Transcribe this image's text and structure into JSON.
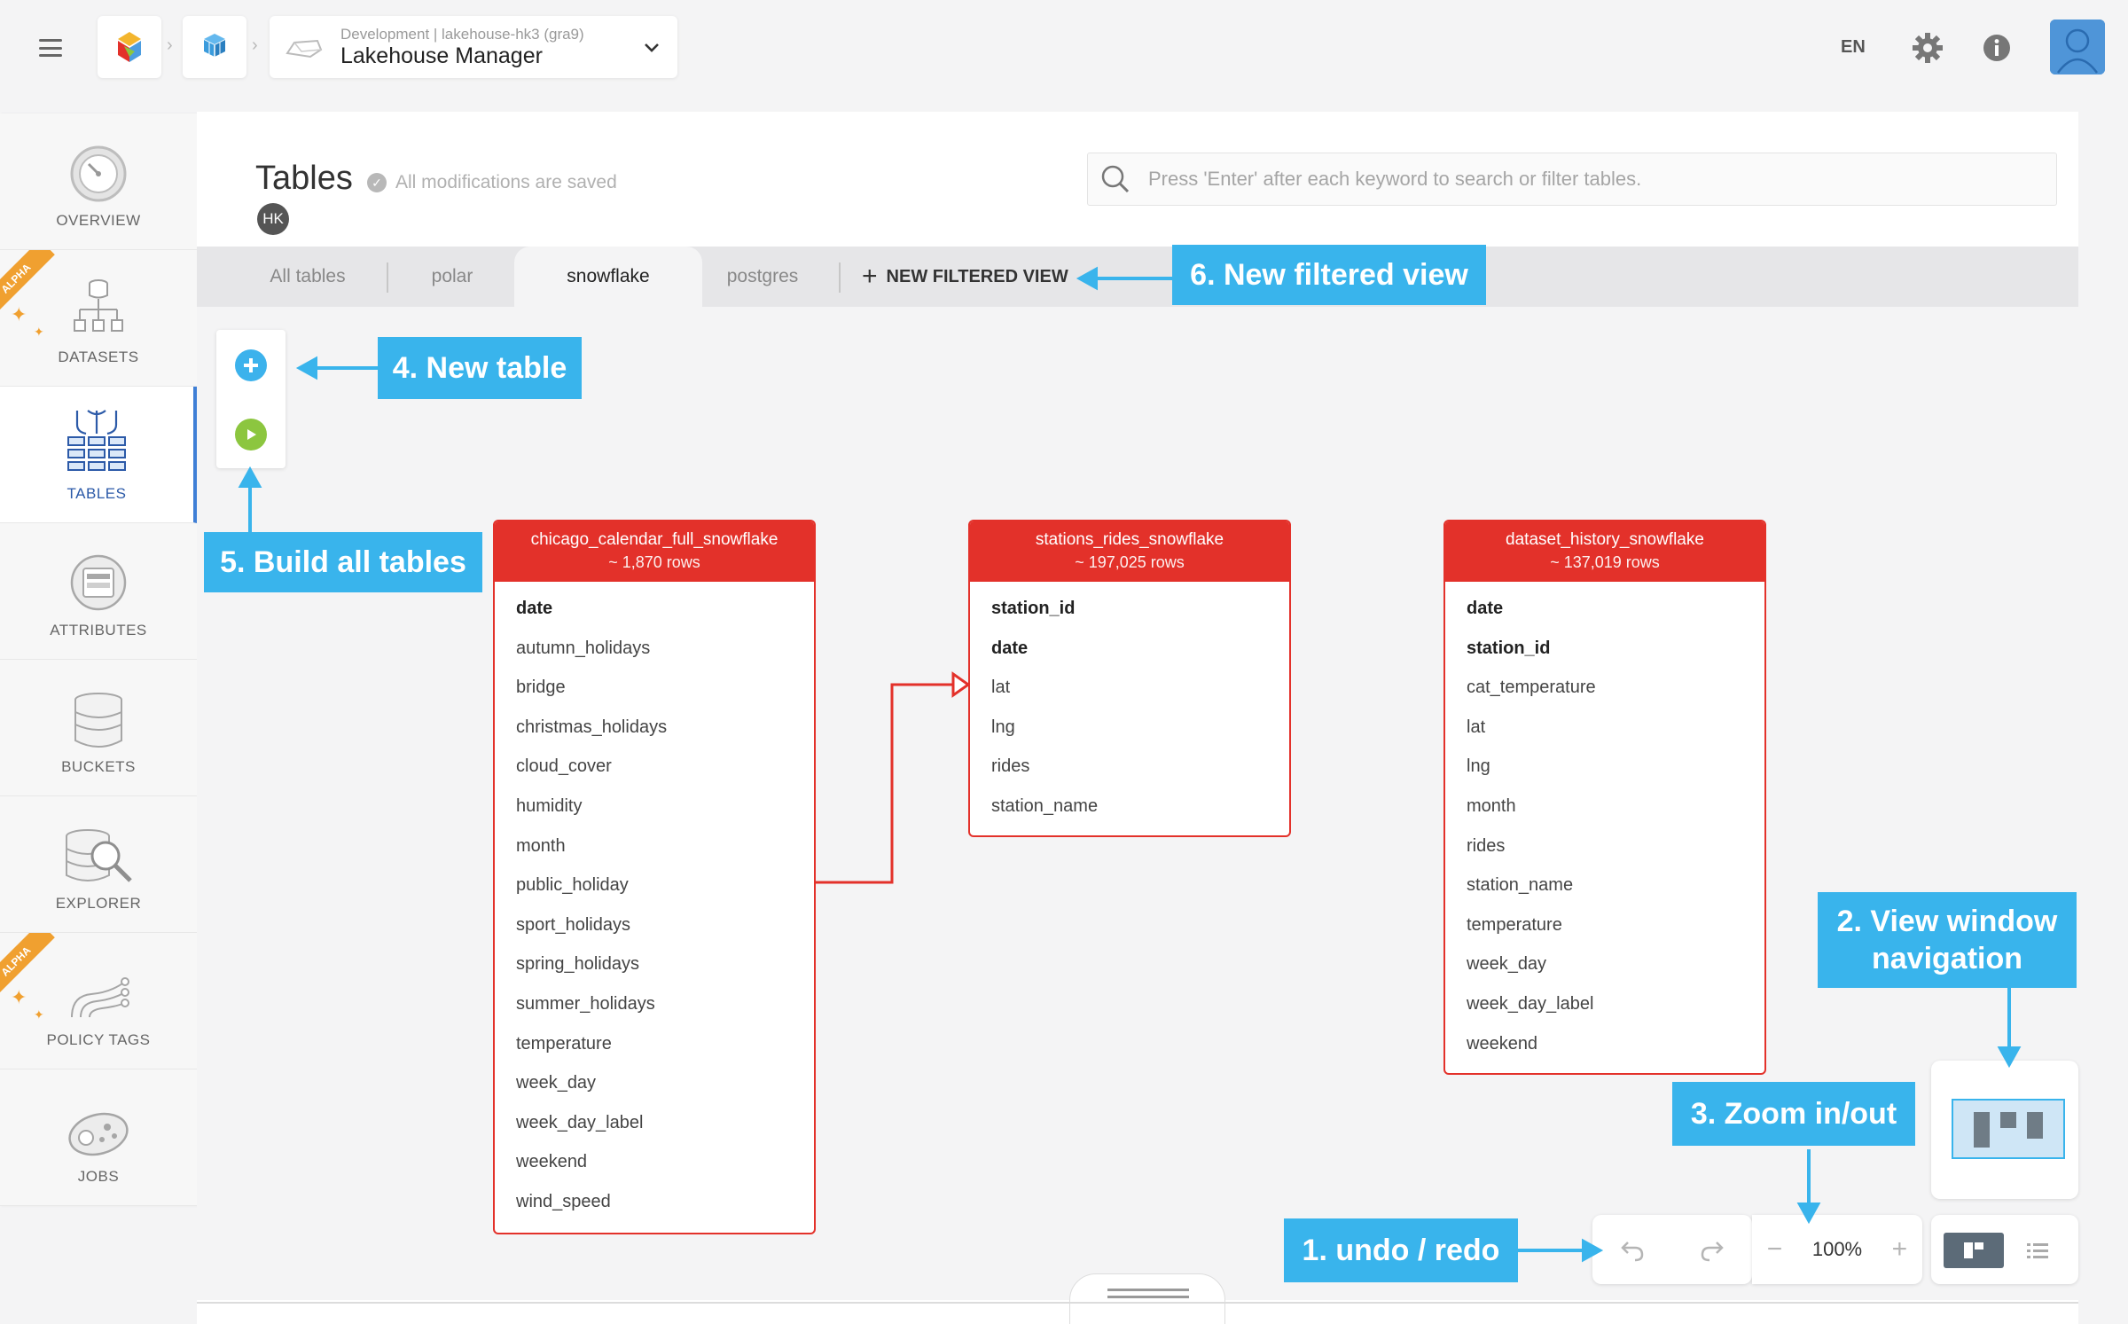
{
  "topbar": {
    "project_context": "Development | lakehouse-hk3 (gra9)",
    "project_name": "Lakehouse Manager",
    "language": "EN"
  },
  "sidebar": {
    "items": [
      {
        "label": "OVERVIEW",
        "icon": "gauge-icon"
      },
      {
        "label": "DATASETS",
        "icon": "dataset-tree-icon",
        "badge": "ALPHA"
      },
      {
        "label": "TABLES",
        "icon": "tables-icon"
      },
      {
        "label": "ATTRIBUTES",
        "icon": "attributes-icon"
      },
      {
        "label": "BUCKETS",
        "icon": "buckets-icon"
      },
      {
        "label": "EXPLORER",
        "icon": "explorer-icon"
      },
      {
        "label": "POLICY TAGS",
        "icon": "policy-tags-icon",
        "badge": "ALPHA"
      },
      {
        "label": "JOBS",
        "icon": "jobs-icon"
      }
    ]
  },
  "page": {
    "title": "Tables",
    "saved_status": "All modifications are saved",
    "user_initials": "HK",
    "search_placeholder": "Press 'Enter' after each keyword to search or filter tables."
  },
  "tabs": {
    "items": [
      "All tables",
      "polar",
      "snowflake",
      "postgres"
    ],
    "active": "snowflake",
    "new_view": "NEW FILTERED VIEW"
  },
  "tables": [
    {
      "name": "chicago_calendar_full_snowflake",
      "rows": "~ 1,870 rows",
      "columns": [
        {
          "name": "date",
          "key": true
        },
        {
          "name": "autumn_holidays",
          "key": false
        },
        {
          "name": "bridge",
          "key": false
        },
        {
          "name": "christmas_holidays",
          "key": false
        },
        {
          "name": "cloud_cover",
          "key": false
        },
        {
          "name": "humidity",
          "key": false
        },
        {
          "name": "month",
          "key": false
        },
        {
          "name": "public_holiday",
          "key": false
        },
        {
          "name": "sport_holidays",
          "key": false
        },
        {
          "name": "spring_holidays",
          "key": false
        },
        {
          "name": "summer_holidays",
          "key": false
        },
        {
          "name": "temperature",
          "key": false
        },
        {
          "name": "week_day",
          "key": false
        },
        {
          "name": "week_day_label",
          "key": false
        },
        {
          "name": "weekend",
          "key": false
        },
        {
          "name": "wind_speed",
          "key": false
        }
      ]
    },
    {
      "name": "stations_rides_snowflake",
      "rows": "~ 197,025 rows",
      "columns": [
        {
          "name": "station_id",
          "key": true
        },
        {
          "name": "date",
          "key": true
        },
        {
          "name": "lat",
          "key": false
        },
        {
          "name": "lng",
          "key": false
        },
        {
          "name": "rides",
          "key": false
        },
        {
          "name": "station_name",
          "key": false
        }
      ]
    },
    {
      "name": "dataset_history_snowflake",
      "rows": "~ 137,019 rows",
      "columns": [
        {
          "name": "date",
          "key": true
        },
        {
          "name": "station_id",
          "key": true
        },
        {
          "name": "cat_temperature",
          "key": false
        },
        {
          "name": "lat",
          "key": false
        },
        {
          "name": "lng",
          "key": false
        },
        {
          "name": "month",
          "key": false
        },
        {
          "name": "rides",
          "key": false
        },
        {
          "name": "station_name",
          "key": false
        },
        {
          "name": "temperature",
          "key": false
        },
        {
          "name": "week_day",
          "key": false
        },
        {
          "name": "week_day_label",
          "key": false
        },
        {
          "name": "weekend",
          "key": false
        }
      ]
    }
  ],
  "zoom": {
    "value": "100%"
  },
  "annotations": {
    "undo_redo": "1. undo / redo",
    "view_nav": "2. View window navigation",
    "zoom": "3. Zoom in/out",
    "new_table": "4. New table",
    "build_all": "5. Build all tables",
    "new_view": "6. New filtered view"
  },
  "colors": {
    "accent_red": "#e3312a",
    "annotation_blue": "#39b4ec",
    "active_blue": "#3f7fd6",
    "alpha_orange": "#f0a030",
    "add_button": "#3cb2ec",
    "build_button": "#8cc63f"
  }
}
